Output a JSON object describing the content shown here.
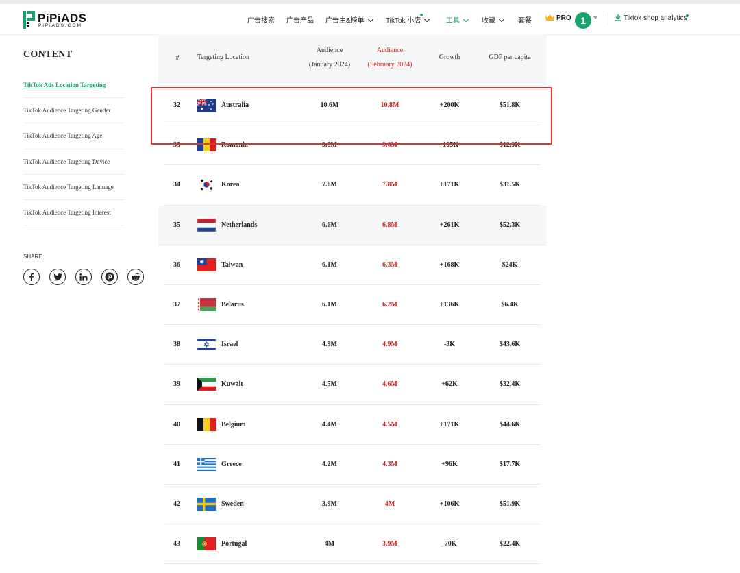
{
  "brand": {
    "name": "PiPiADS",
    "sub": "PiPiADS.COM",
    "color": "#1aa36d"
  },
  "nav": {
    "items": [
      {
        "label": "广告搜索",
        "dropdown": false
      },
      {
        "label": "广告产品",
        "dropdown": false
      },
      {
        "label": "广告主&榜单",
        "dropdown": true
      },
      {
        "label": "TikTok 小店",
        "dropdown": true,
        "dot": true
      },
      {
        "label": "工具",
        "dropdown": true,
        "active": true
      },
      {
        "label": "收藏",
        "dropdown": true
      },
      {
        "label": "套餐",
        "dropdown": false
      }
    ],
    "pro_label": "PRO",
    "avatar_text": "1",
    "download_label": "Tiktok shop analytics"
  },
  "sidebar": {
    "title": "CONTENT",
    "items": [
      {
        "label": "TikTok Ads Location Targeting",
        "active": true
      },
      {
        "label": "TikTok Audience Targeting Gender"
      },
      {
        "label": "TikTok Audience Targeting Age"
      },
      {
        "label": "TikTok Audience Targeting Device"
      },
      {
        "label": "TikTok Audience Targeting Lanuage"
      },
      {
        "label": "TikTok Audience Targeting Interest"
      }
    ],
    "share_label": "SHARE",
    "share_icons": [
      "facebook-icon",
      "twitter-icon",
      "linkedin-icon",
      "pinterest-icon",
      "reddit-icon"
    ]
  },
  "table": {
    "headers": {
      "rank": "#",
      "location": "Targeting Location",
      "jan": [
        "Audience",
        "(January 2024)"
      ],
      "feb": [
        "Audience",
        "(February 2024)"
      ],
      "growth": "Growth",
      "gdp": "GDP per capita"
    },
    "accent_red": "#e02020",
    "rows": [
      {
        "rank": "32",
        "country": "Australia",
        "jan": "10.6M",
        "feb": "10.8M",
        "growth": "+200K",
        "gdp": "$51.8K",
        "flag": "australia"
      },
      {
        "rank": "33",
        "country": "Romania",
        "jan": "9.8M",
        "feb": "9.6M",
        "growth": "-185K",
        "gdp": "$12.9K",
        "flag": "romania"
      },
      {
        "rank": "34",
        "country": "Korea",
        "jan": "7.6M",
        "feb": "7.8M",
        "growth": "+171K",
        "gdp": "$31.5K",
        "flag": "korea"
      },
      {
        "rank": "35",
        "country": "Netherlands",
        "jan": "6.6M",
        "feb": "6.8M",
        "growth": "+261K",
        "gdp": "$52.3K",
        "flag": "netherlands"
      },
      {
        "rank": "36",
        "country": "Taiwan",
        "jan": "6.1M",
        "feb": "6.3M",
        "growth": "+168K",
        "gdp": "$24K",
        "flag": "taiwan"
      },
      {
        "rank": "37",
        "country": "Belarus",
        "jan": "6.1M",
        "feb": "6.2M",
        "growth": "+136K",
        "gdp": "$6.4K",
        "flag": "belarus"
      },
      {
        "rank": "38",
        "country": "Israel",
        "jan": "4.9M",
        "feb": "4.9M",
        "growth": "-3K",
        "gdp": "$43.6K",
        "flag": "israel"
      },
      {
        "rank": "39",
        "country": "Kuwait",
        "jan": "4.5M",
        "feb": "4.6M",
        "growth": "+62K",
        "gdp": "$32.4K",
        "flag": "kuwait"
      },
      {
        "rank": "40",
        "country": "Belgium",
        "jan": "4.4M",
        "feb": "4.5M",
        "growth": "+171K",
        "gdp": "$44.6K",
        "flag": "belgium"
      },
      {
        "rank": "41",
        "country": "Greece",
        "jan": "4.2M",
        "feb": "4.3M",
        "growth": "+96K",
        "gdp": "$17.7K",
        "flag": "greece"
      },
      {
        "rank": "42",
        "country": "Sweden",
        "jan": "3.9M",
        "feb": "4M",
        "growth": "+106K",
        "gdp": "$51.9K",
        "flag": "sweden"
      },
      {
        "rank": "43",
        "country": "Portugal",
        "jan": "4M",
        "feb": "3.9M",
        "growth": "-70K",
        "gdp": "$22.4K",
        "flag": "portugal"
      }
    ]
  }
}
